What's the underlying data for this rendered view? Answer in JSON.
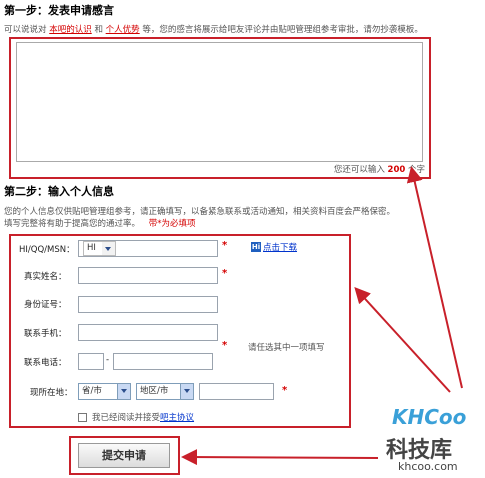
{
  "step1": {
    "title": "第一步：发表申请感言",
    "desc_prefix": "可以说说对",
    "link1": "本吧的认识",
    "desc_and": "和",
    "link2": "个人优势",
    "desc_suffix": "等，您的感言将展示给吧友评论并由贴吧管理组参考审批，请勿抄袭模板。",
    "textarea_value": "",
    "counter_prefix": "您还可以输入",
    "counter_value": "200",
    "counter_suffix": "个字"
  },
  "step2": {
    "title": "第二步：输入个人信息",
    "desc_line1": "您的个人信息仅供贴吧管理组参考，请正确填写，以备紧急联系或活动通知，相关资料百度会严格保密。",
    "desc_line2": "填写完整将有助于提高您的通过率。",
    "required_note": "带*为必填项"
  },
  "form": {
    "hi_label": "HI/QQ/MSN：",
    "hi_select": "HI",
    "hi_download": "点击下载",
    "name_label": "真实姓名：",
    "id_label": "身份证号：",
    "mobile_label": "联系手机：",
    "phone_label": "联系电话：",
    "phone_dash": "-",
    "contact_hint": "请任选其中一项填写",
    "location_label": "现所在地：",
    "province_select": "省/市",
    "district_select": "地区/市",
    "agree_prefix": "我已经阅读并接受",
    "agree_link": "吧主协议",
    "star": "*",
    "submit": "提交申请"
  },
  "watermark": {
    "logo": "KHCoo",
    "name": "科技库",
    "url": "khcoo.com"
  },
  "colors": {
    "accent_red": "#c8202a",
    "link_red": "#d40000",
    "link_blue": "#0033cc"
  }
}
